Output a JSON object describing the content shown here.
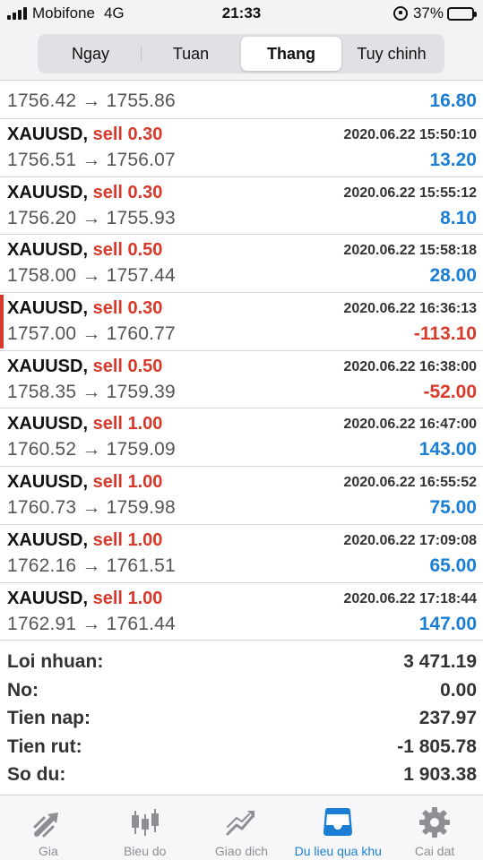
{
  "status": {
    "carrier": "Mobifone",
    "network": "4G",
    "time": "21:33",
    "battery": "37%"
  },
  "tabs": {
    "day": "Ngay",
    "week": "Tuan",
    "month": "Thang",
    "custom": "Tuy chinh"
  },
  "deals": [
    {
      "prices": "1756.42 → 1755.86",
      "profit": "16.80"
    },
    {
      "symbol": "XAUUSD,",
      "side": "sell 0.30",
      "time": "2020.06.22 15:50:10",
      "prices": "1756.51 → 1756.07",
      "profit": "13.20"
    },
    {
      "symbol": "XAUUSD,",
      "side": "sell 0.30",
      "time": "2020.06.22 15:55:12",
      "prices": "1756.20 → 1755.93",
      "profit": "8.10"
    },
    {
      "symbol": "XAUUSD,",
      "side": "sell 0.50",
      "time": "2020.06.22 15:58:18",
      "prices": "1758.00 → 1757.44",
      "profit": "28.00"
    },
    {
      "symbol": "XAUUSD,",
      "side": "sell 0.30",
      "time": "2020.06.22 16:36:13",
      "prices": "1757.00 → 1760.77",
      "profit": "-113.10"
    },
    {
      "symbol": "XAUUSD,",
      "side": "sell 0.50",
      "time": "2020.06.22 16:38:00",
      "prices": "1758.35 → 1759.39",
      "profit": "-52.00"
    },
    {
      "symbol": "XAUUSD,",
      "side": "sell 1.00",
      "time": "2020.06.22 16:47:00",
      "prices": "1760.52 → 1759.09",
      "profit": "143.00"
    },
    {
      "symbol": "XAUUSD,",
      "side": "sell 1.00",
      "time": "2020.06.22 16:55:52",
      "prices": "1760.73 → 1759.98",
      "profit": "75.00"
    },
    {
      "symbol": "XAUUSD,",
      "side": "sell 1.00",
      "time": "2020.06.22 17:09:08",
      "prices": "1762.16 → 1761.51",
      "profit": "65.00"
    },
    {
      "symbol": "XAUUSD,",
      "side": "sell 1.00",
      "time": "2020.06.22 17:18:44",
      "prices": "1762.91 → 1761.44",
      "profit": "147.00"
    }
  ],
  "summary": {
    "profit_label": "Loi nhuan:",
    "profit_value": "3 471.19",
    "credit_label": "No:",
    "credit_value": "0.00",
    "deposit_label": "Tien nap:",
    "deposit_value": "237.97",
    "withdrawal_label": "Tien rut:",
    "withdrawal_value": "-1 805.78",
    "balance_label": "So du:",
    "balance_value": "1 903.38"
  },
  "tabbar": {
    "quotes": "Gia",
    "chart": "Bieu do",
    "trade": "Giao dich",
    "history": "Du lieu qua khu",
    "settings": "Cai dat"
  },
  "colors": {
    "accent": "#1a7fd4",
    "loss": "#d9392b",
    "inactive": "#8e8e93"
  },
  "icons": [
    "signal-icon",
    "orientation-lock-icon",
    "battery-icon",
    "quotes-arrows-icon",
    "candlestick-chart-icon",
    "trade-chart-icon",
    "inbox-history-icon",
    "gear-icon"
  ]
}
